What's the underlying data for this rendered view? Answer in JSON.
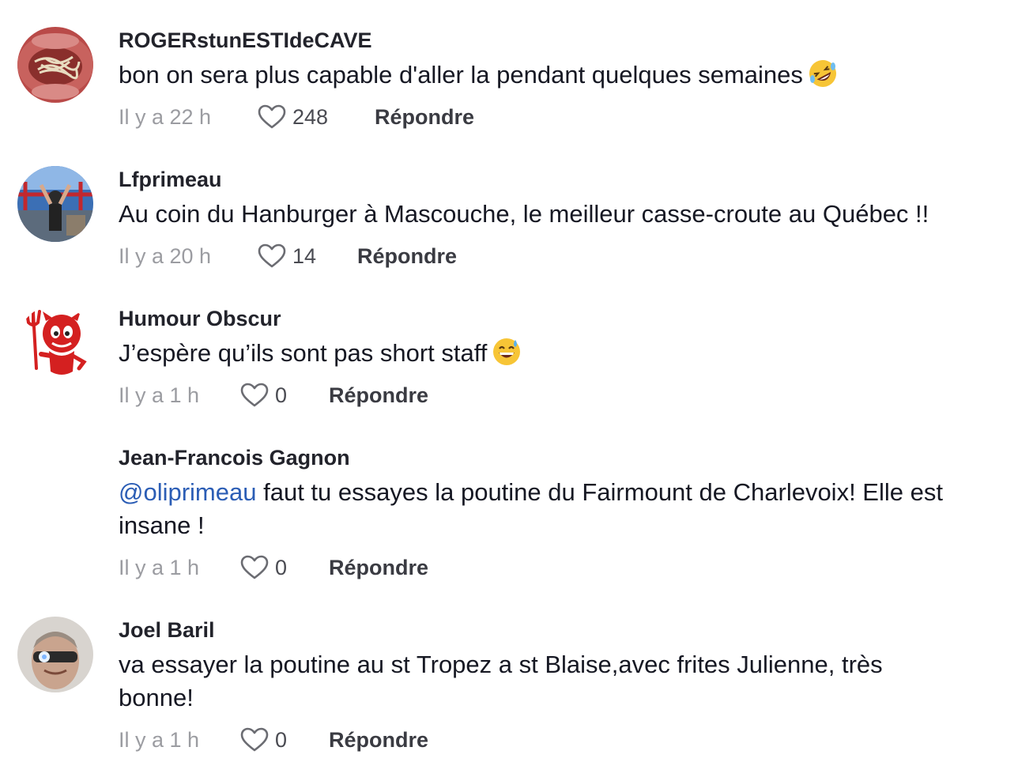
{
  "reply_label": "Répondre",
  "comments": [
    {
      "username": "ROGERstunESTIdeCAVE",
      "text": "bon on sera plus capable d'aller la pendant quelques semaines",
      "emoji": "rolling-on-floor-laughing-emoji",
      "time": "Il y a 22 h",
      "likes": "248"
    },
    {
      "username": "Lfprimeau",
      "text": "Au coin du Hanburger à Mascouche, le meilleur casse-croute au Québec !!",
      "time": "Il y a 20 h",
      "likes": "14"
    },
    {
      "username": "Humour Obscur",
      "text": "J’espère qu’ils sont pas short staff",
      "emoji": "grinning-sweat-emoji",
      "time": "Il y a 1 h",
      "likes": "0"
    },
    {
      "username": "Jean-Francois Gagnon",
      "mention": "@oliprimeau",
      "text": " faut tu essayes la poutine du Fairmount de Charlevoix! Elle est insane !",
      "time": "Il y a 1 h",
      "likes": "0"
    },
    {
      "username": "Joel Baril",
      "text": "va essayer la poutine au st Tropez a st Blaise,avec frites Julienne, très bonne!",
      "time": "Il y a 1 h",
      "likes": "0"
    }
  ],
  "colors": {
    "text": "#161823",
    "secondary": "#9b9ca1",
    "mention": "#2b5db5"
  }
}
